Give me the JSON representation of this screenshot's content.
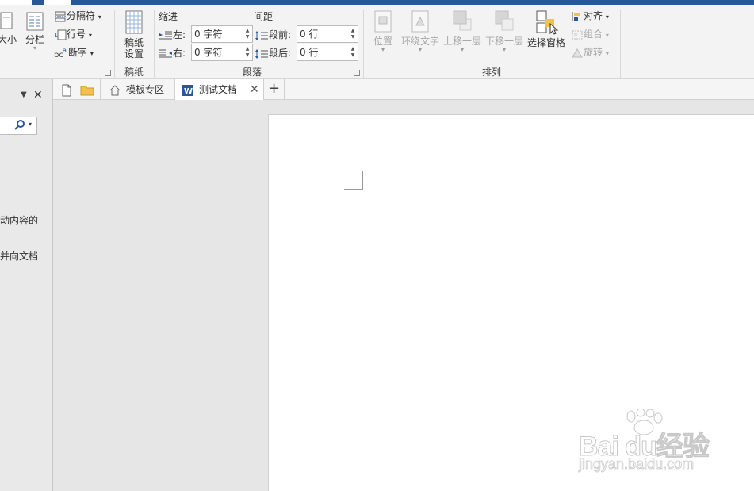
{
  "ribbon": {
    "size_label": "大小",
    "columns_label": "分栏",
    "breaks_label": "分隔符",
    "line_numbers_label": "行号",
    "hyphenation_label": "断字",
    "manuscript_btn_line1": "稿纸",
    "manuscript_btn_line2": "设置",
    "manuscript_group": "稿纸",
    "indent_header": "缩进",
    "spacing_header": "间距",
    "indent_left_label": "左:",
    "indent_left_value": "0 字符",
    "indent_right_label": "右:",
    "indent_right_value": "0 字符",
    "spacing_before_label": "段前:",
    "spacing_before_value": "0 行",
    "spacing_after_label": "段后:",
    "spacing_after_value": "0 行",
    "paragraph_group": "段落",
    "position_label": "位置",
    "wrap_text_label": "环绕文字",
    "bring_forward_label": "上移一层",
    "send_backward_label": "下移一层",
    "selection_pane_label": "选择窗格",
    "align_label": "对齐",
    "group_label": "组合",
    "rotate_label": "旋转",
    "arrange_group": "排列"
  },
  "left_pane": {
    "text1": "动内容的",
    "text2": "并向文档"
  },
  "tabs": [
    {
      "label": "模板专区"
    },
    {
      "label": "测试文档"
    }
  ],
  "watermark": {
    "brand": "Bai du经验",
    "url": "jingyan.baidu.com"
  },
  "colors": {
    "accent": "#2b579a",
    "word_icon": "#2b579a",
    "folder": "#f2c14e"
  }
}
